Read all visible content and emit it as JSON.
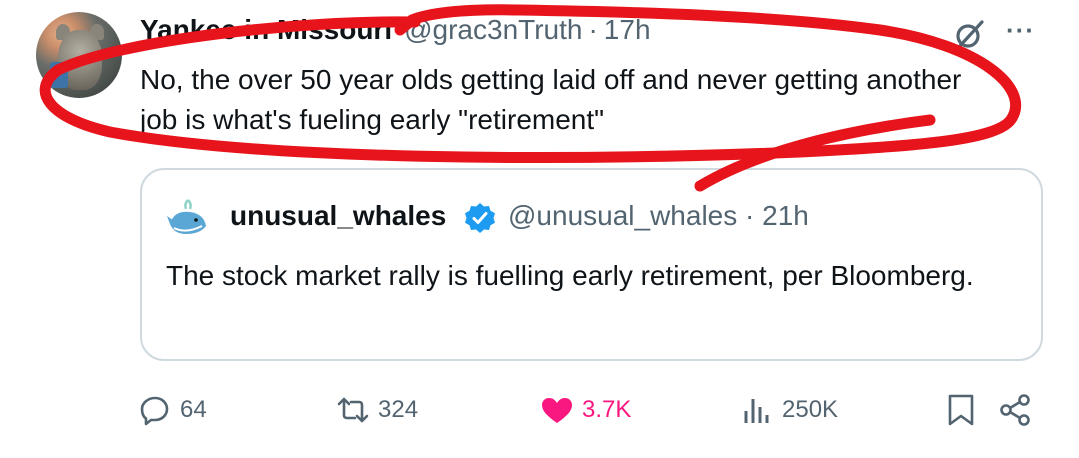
{
  "tweet": {
    "display_name": "Yankee in Missouri",
    "handle": "@grac3nTruth",
    "separator": "·",
    "time": "17h",
    "text": "No, the over 50 year olds getting laid off and never getting another job is what's fueling early \"retirement\"",
    "more_label": "···"
  },
  "quote": {
    "display_name": "unusual_whales",
    "handle": "@unusual_whales",
    "separator": "·",
    "time": "21h",
    "text": "The stock market rally is fuelling early retirement, per Bloomberg."
  },
  "actions": {
    "replies": "64",
    "reposts": "324",
    "likes": "3.7K",
    "views": "250K"
  },
  "icons": {
    "reply": "reply-icon",
    "repost": "repost-icon",
    "like": "heart-icon",
    "views": "views-icon",
    "bookmark": "bookmark-icon",
    "share": "share-icon",
    "grok": "grok-icon",
    "more": "more-icon",
    "verified": "verified-badge-icon"
  },
  "colors": {
    "like_active": "#f91880",
    "verified_blue": "#1d9bf0",
    "secondary_text": "#536471",
    "annotation_red": "#e8141b"
  }
}
